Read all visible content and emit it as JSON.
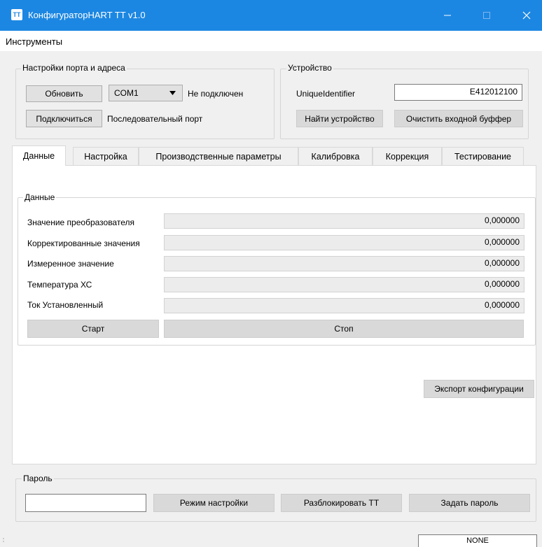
{
  "window": {
    "icon_text": "TT",
    "title": "КонфигураторHART TT v1.0"
  },
  "menu": {
    "tools": "Инструменты"
  },
  "port_settings": {
    "title": "Настройки порта и адреса",
    "refresh_label": "Обновить",
    "port_selected": "COM1",
    "connection_status": "Не подключен",
    "connect_label": "Подключиться",
    "port_type": "Последовательный порт"
  },
  "device": {
    "title": "Устройство",
    "unique_id_label": "UniqueIdentifier",
    "unique_id_value": "E412012100",
    "find_label": "Найти устройство",
    "clear_buffer_label": "Очистить входной буффер"
  },
  "tabs": [
    {
      "label": "Данные",
      "active": true
    },
    {
      "label": "Настройка"
    },
    {
      "label": "Производственные параметры"
    },
    {
      "label": "Калибровка"
    },
    {
      "label": "Коррекция"
    },
    {
      "label": "Тестирование"
    }
  ],
  "data_group": {
    "title": "Данные",
    "rows": [
      {
        "label": "Значение преобразователя",
        "value": "0,000000"
      },
      {
        "label": "Корректированные значения",
        "value": "0,000000"
      },
      {
        "label": "Измеренное значение",
        "value": "0,000000"
      },
      {
        "label": "Температура ХС",
        "value": "0,000000"
      },
      {
        "label": "Ток Установленный",
        "value": "0,000000"
      }
    ],
    "start_label": "Старт",
    "stop_label": "Стоп"
  },
  "export_label": "Экспорт конфигурации",
  "password": {
    "title": "Пароль",
    "value": "",
    "setup_mode_label": "Режим настройки",
    "unlock_label": "Разблокировать ТТ",
    "set_password_label": "Задать пароль"
  },
  "status": {
    "value": "NONE"
  },
  "colors": {
    "titlebar": "#1c87e2",
    "window_bg": "#f0f0f0",
    "panel_bg": "#ffffff"
  }
}
